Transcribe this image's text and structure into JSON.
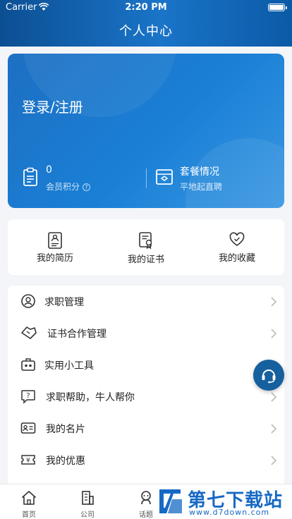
{
  "status_bar": {
    "carrier": "Carrier",
    "time": "2:20 PM"
  },
  "header": {
    "title": "个人中心"
  },
  "profile_card": {
    "login_label": "登录/注册",
    "points_value": "0",
    "points_label": "会员积分",
    "package_title": "套餐情况",
    "package_subtitle": "平地起直聘"
  },
  "quick_links": [
    {
      "label": "我的简历",
      "icon": "resume-icon"
    },
    {
      "label": "我的证书",
      "icon": "certificate-icon"
    },
    {
      "label": "我的收藏",
      "icon": "heart-icon"
    }
  ],
  "menu": [
    {
      "label": "求职管理",
      "icon": "user-circle-icon"
    },
    {
      "label": "证书合作管理",
      "icon": "handshake-icon"
    },
    {
      "label": "实用小工具",
      "icon": "toolbox-icon"
    },
    {
      "label": "求职帮助，牛人帮你",
      "icon": "help-chat-icon"
    },
    {
      "label": "我的名片",
      "icon": "business-card-icon"
    },
    {
      "label": "我的优惠",
      "icon": "coupon-icon"
    }
  ],
  "tabbar": [
    {
      "label": "首页",
      "icon": "home-icon"
    },
    {
      "label": "公司",
      "icon": "building-icon"
    },
    {
      "label": "话题",
      "icon": "topic-icon"
    }
  ],
  "watermark": {
    "title": "第七下载站",
    "url": "www.d7down.com"
  },
  "colors": {
    "header": "#1a74c8",
    "card": "#1a80d6",
    "background": "#f3f5f8",
    "watermark": "#1769c4"
  }
}
